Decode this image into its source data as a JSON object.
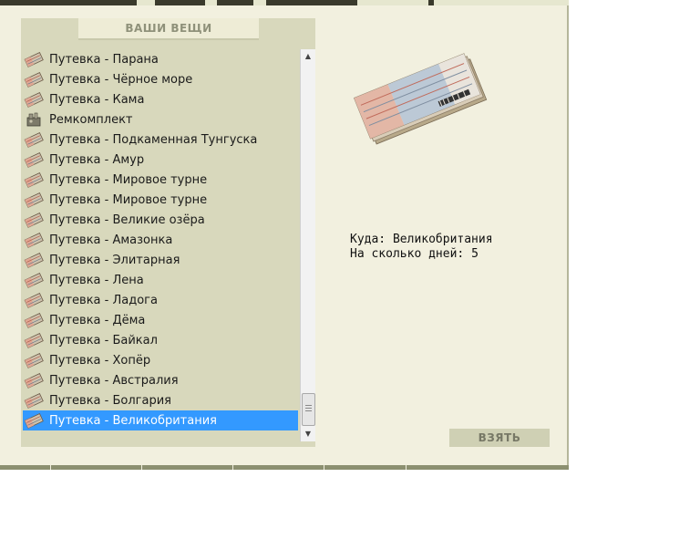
{
  "panel": {
    "title": "ВАШИ ВЕЩИ"
  },
  "items": [
    {
      "label": "Путевка - Парана",
      "icon": "ticket-icon"
    },
    {
      "label": "Путевка - Чёрное море",
      "icon": "ticket-icon"
    },
    {
      "label": "Путевка - Кама",
      "icon": "ticket-icon"
    },
    {
      "label": "Ремкомплект",
      "icon": "repair-kit-icon"
    },
    {
      "label": "Путевка - Подкаменная Тунгуска",
      "icon": "ticket-icon"
    },
    {
      "label": "Путевка - Амур",
      "icon": "ticket-icon"
    },
    {
      "label": "Путевка - Мировое турне",
      "icon": "ticket-icon"
    },
    {
      "label": "Путевка - Мировое турне",
      "icon": "ticket-icon"
    },
    {
      "label": "Путевка - Великие озёра",
      "icon": "ticket-icon"
    },
    {
      "label": "Путевка - Амазонка",
      "icon": "ticket-icon"
    },
    {
      "label": "Путевка - Элитарная",
      "icon": "ticket-icon"
    },
    {
      "label": "Путевка - Лена",
      "icon": "ticket-icon"
    },
    {
      "label": "Путевка - Ладога",
      "icon": "ticket-icon"
    },
    {
      "label": "Путевка - Дёма",
      "icon": "ticket-icon"
    },
    {
      "label": "Путевка - Байкал",
      "icon": "ticket-icon"
    },
    {
      "label": "Путевка - Хопёр",
      "icon": "ticket-icon"
    },
    {
      "label": "Путевка - Австралия",
      "icon": "ticket-icon"
    },
    {
      "label": "Путевка - Болгария",
      "icon": "ticket-icon"
    },
    {
      "label": "Путевка - Великобритания",
      "icon": "ticket-icon"
    }
  ],
  "selected_index": 18,
  "details": {
    "destination_label": "Куда:",
    "destination_value": "Великобритания",
    "days_label": "На сколько дней:",
    "days_value": "5"
  },
  "take_button": "ВЗЯТЬ",
  "colors": {
    "selection": "#3399ff",
    "panel": "#d8d8bc",
    "window": "#f2f0df"
  }
}
